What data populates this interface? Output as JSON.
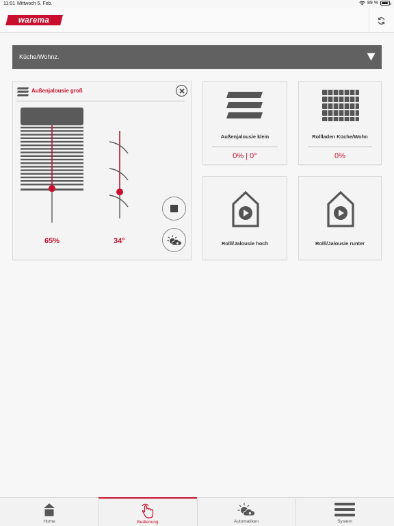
{
  "status_bar": {
    "time": "11:01",
    "date": "Mittwoch 5. Feb.",
    "battery": "89 %",
    "battery_level": 0.89
  },
  "header": {
    "logo_text": "warema"
  },
  "room_selector": {
    "value": "Küche/Wohnz."
  },
  "expanded_card": {
    "title": "Außenjalousie groß",
    "position_percent": 65,
    "position_label": "65%",
    "slat_angle_percent": 34,
    "slat_label": "34°"
  },
  "cards": [
    {
      "title": "Außenjalousie klein",
      "value": "0% | 0°",
      "icon": "blind-icon"
    },
    {
      "title": "Rollladen Küche/Wohn",
      "value": "0%",
      "icon": "roller-shutter-icon"
    },
    {
      "title": "Rolll/Jalousie hoch",
      "icon": "scene-house-play-icon"
    },
    {
      "title": "Rolll/Jalousie runter",
      "icon": "scene-house-play-icon"
    }
  ],
  "tabs": [
    {
      "label": "Home",
      "icon": "home-icon",
      "active": false
    },
    {
      "label": "Bedienung",
      "icon": "touch-hand-icon",
      "active": true
    },
    {
      "label": "Automatiken",
      "icon": "sun-cloud-icon",
      "active": false
    },
    {
      "label": "System",
      "icon": "list-icon",
      "active": false
    }
  ],
  "colors": {
    "accent": "#c8102e",
    "room_bar": "#616161",
    "icon_gray": "#555555"
  }
}
